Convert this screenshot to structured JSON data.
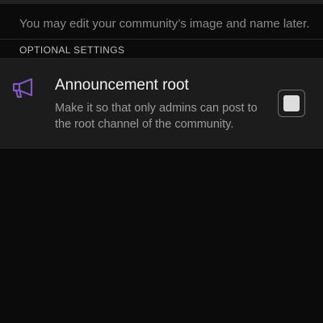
{
  "hint_text": "You may edit your community’s image and name later.",
  "section_label": "OPTIONAL SETTINGS",
  "settings": {
    "announcement_root": {
      "icon": "megaphone-icon",
      "icon_color": "#7e57c2",
      "title": "Announcement root",
      "description": "Make it so that only admins can post to the root channel of the community.",
      "checked": false
    }
  }
}
